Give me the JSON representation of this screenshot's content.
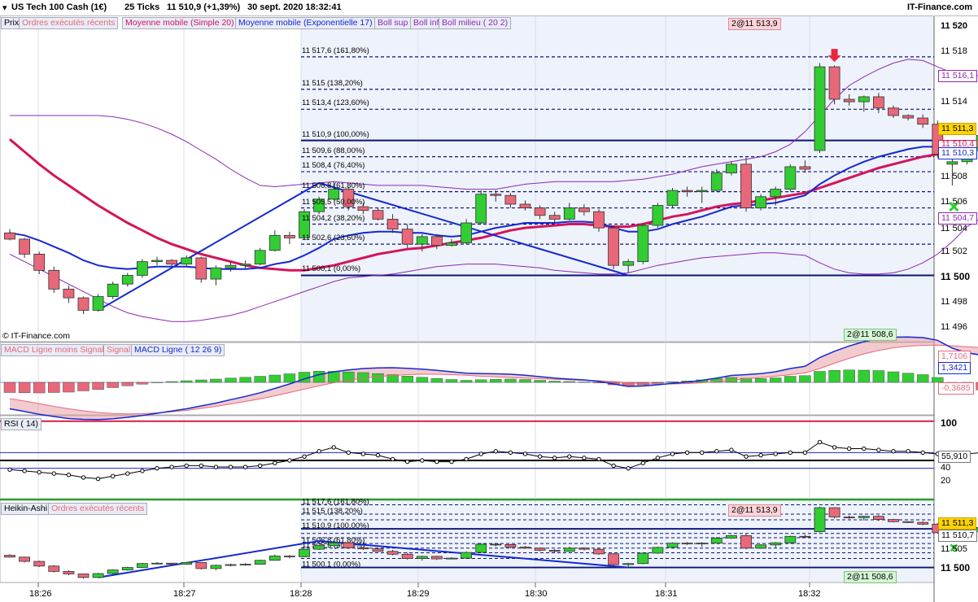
{
  "header": {
    "instrument": "US Tech 100 Cash (1€)",
    "ticks": "25 Ticks",
    "quote": "11 510,9 (+1,39%)",
    "datetime": "30 sept. 2020 18:32:41",
    "brand": "IT-Finance.com"
  },
  "panels": {
    "price": {
      "legend": [
        "Prix",
        "Ordres exécutés récents",
        "Moyenne mobile (Simple 20)",
        "Moyenne mobile (Exponentielle 17)",
        "Boll sup",
        "Boll inf",
        "Boll milieu ( 20 2)"
      ],
      "copyright": "© IT-Finance.com",
      "order_top": "2@11 513,9",
      "order_bottom": "2@11 508,6",
      "axis_ticks": [
        "11 520",
        "11 518",
        "11 516",
        "11 514",
        "11 512",
        "11 510",
        "11 508",
        "11 506",
        "11 504",
        "11 502",
        "11 500",
        "11 498",
        "11 496"
      ],
      "tags": {
        "boll_up": "11 516,1",
        "close": "11 511,3",
        "sma": "11 510,4",
        "ema": "11 510,3",
        "boll_low": "11 504,7"
      }
    },
    "macd": {
      "legend": [
        "MACD Ligne moins Signal",
        "Signal",
        "MACD Ligne ( 12 26 9)"
      ],
      "tags": {
        "signal": "1,7106",
        "macd": "1,3421",
        "hist": "-0,3685"
      }
    },
    "rsi": {
      "legend": [
        "RSI ( 14)"
      ],
      "axis_ticks": [
        "100",
        "60",
        "40",
        "20"
      ],
      "tags": {
        "rsi": "55,910"
      }
    },
    "ha": {
      "legend": [
        "Heikin-Ashi",
        "Ordres exécutés récents"
      ],
      "order_top": "2@11 513,9",
      "order_bottom": "2@11 508,6",
      "axis_ticks": [
        "11 505",
        "11 500"
      ],
      "tags": {
        "close": "11 511,3",
        "sma": "11 510,7"
      }
    }
  },
  "time_labels": [
    "18:26",
    "18:27",
    "18:28",
    "18:29",
    "18:30",
    "18:31",
    "18:32"
  ],
  "chart_data": {
    "type": "candlestick",
    "ylim": [
      11495,
      11521
    ],
    "colors": {
      "up": "#32cd32",
      "down": "#e8687a",
      "sma": "#d4145a",
      "ema": "#1428d2",
      "boll": "#8c28b4",
      "fib": "#0a1478",
      "rsi_hi": "#d21e46",
      "rsi_lo": "#14a014"
    },
    "candles": [
      [
        11503.5,
        11503.8,
        11502.9,
        11503.0
      ],
      [
        11503.0,
        11503.1,
        11501.5,
        11501.8
      ],
      [
        11501.8,
        11502.0,
        11500.2,
        11500.5
      ],
      [
        11500.5,
        11500.8,
        11498.7,
        11499.0
      ],
      [
        11499.0,
        11499.3,
        11497.9,
        11498.3
      ],
      [
        11498.3,
        11498.4,
        11497.0,
        11497.3
      ],
      [
        11497.3,
        11498.6,
        11497.2,
        11498.4
      ],
      [
        11498.4,
        11499.6,
        11498.2,
        11499.4
      ],
      [
        11499.4,
        11500.3,
        11499.2,
        11500.1
      ],
      [
        11500.1,
        11501.4,
        11499.9,
        11501.2
      ],
      [
        11501.2,
        11501.6,
        11500.9,
        11501.3
      ],
      [
        11501.3,
        11501.4,
        11500.8,
        11501.0
      ],
      [
        11501.0,
        11501.7,
        11500.8,
        11501.5
      ],
      [
        11501.5,
        11501.6,
        11499.5,
        11499.8
      ],
      [
        11499.8,
        11500.9,
        11499.3,
        11500.7
      ],
      [
        11500.7,
        11501.2,
        11500.4,
        11500.9
      ],
      [
        11500.9,
        11501.3,
        11500.6,
        11501.0
      ],
      [
        11501.0,
        11502.3,
        11500.9,
        11502.1
      ],
      [
        11502.1,
        11503.7,
        11502.0,
        11503.3
      ],
      [
        11503.3,
        11503.6,
        11502.6,
        11503.1
      ],
      [
        11503.1,
        11505.4,
        11503.0,
        11505.2
      ],
      [
        11505.2,
        11506.4,
        11505.0,
        11506.2
      ],
      [
        11506.2,
        11507.6,
        11506.1,
        11507.0
      ],
      [
        11507.0,
        11507.2,
        11505.3,
        11505.6
      ],
      [
        11505.6,
        11505.9,
        11505.0,
        11505.3
      ],
      [
        11505.3,
        11505.5,
        11504.5,
        11504.6
      ],
      [
        11504.6,
        11505.0,
        11503.5,
        11503.8
      ],
      [
        11503.8,
        11504.2,
        11502.3,
        11502.6
      ],
      [
        11502.6,
        11503.4,
        11502.0,
        11503.2
      ],
      [
        11503.2,
        11503.4,
        11502.2,
        11502.5
      ],
      [
        11502.5,
        11503.0,
        11502.4,
        11502.7
      ],
      [
        11502.7,
        11504.6,
        11502.6,
        11504.3
      ],
      [
        11504.3,
        11506.9,
        11504.2,
        11506.6
      ],
      [
        11506.6,
        11506.9,
        11506.0,
        11506.5
      ],
      [
        11506.5,
        11506.7,
        11505.5,
        11505.8
      ],
      [
        11505.8,
        11506.1,
        11505.3,
        11505.5
      ],
      [
        11505.5,
        11505.7,
        11504.6,
        11504.9
      ],
      [
        11504.9,
        11505.2,
        11504.3,
        11504.6
      ],
      [
        11504.6,
        11505.9,
        11504.5,
        11505.5
      ],
      [
        11505.5,
        11505.8,
        11504.9,
        11505.2
      ],
      [
        11505.2,
        11505.4,
        11503.6,
        11503.9
      ],
      [
        11503.9,
        11504.1,
        11500.6,
        11500.9
      ],
      [
        11500.9,
        11501.4,
        11500.3,
        11501.2
      ],
      [
        11501.2,
        11504.3,
        11501.0,
        11504.1
      ],
      [
        11504.1,
        11505.9,
        11503.9,
        11505.7
      ],
      [
        11505.7,
        11507.1,
        11505.5,
        11506.9
      ],
      [
        11506.9,
        11507.2,
        11506.4,
        11506.8
      ],
      [
        11506.8,
        11507.2,
        11505.9,
        11506.9
      ],
      [
        11506.9,
        11508.6,
        11506.8,
        11508.3
      ],
      [
        11508.3,
        11509.2,
        11508.1,
        11509.0
      ],
      [
        11509.0,
        11509.5,
        11505.2,
        11505.5
      ],
      [
        11505.5,
        11506.6,
        11505.3,
        11506.4
      ],
      [
        11506.4,
        11507.2,
        11505.7,
        11507.0
      ],
      [
        11507.0,
        11509.0,
        11506.8,
        11508.8
      ],
      [
        11508.8,
        11509.3,
        11508.3,
        11508.6
      ],
      [
        11510.1,
        11517.1,
        11509.9,
        11516.8
      ],
      [
        11516.8,
        11516.9,
        11513.8,
        11514.2
      ],
      [
        11514.2,
        11514.6,
        11513.7,
        11514.0
      ],
      [
        11514.0,
        11514.5,
        11513.2,
        11514.4
      ],
      [
        11514.4,
        11514.7,
        11513.1,
        11513.5
      ],
      [
        11513.5,
        11513.7,
        11512.7,
        11512.9
      ],
      [
        11512.9,
        11513.0,
        11512.5,
        11512.7
      ],
      [
        11512.7,
        11513.0,
        11511.9,
        11512.2
      ],
      [
        11512.2,
        11512.5,
        11509.5,
        11509.8
      ],
      [
        11509.0,
        11509.4,
        11507.3,
        11509.2
      ],
      [
        11509.2,
        11510.4,
        11509.0,
        11510.1
      ],
      [
        11510.1,
        11511.7,
        11510.0,
        11511.3
      ]
    ],
    "sma20": [
      11511.0,
      11510.0,
      11509.0,
      11508.1,
      11507.3,
      11506.5,
      11505.7,
      11505.0,
      11504.3,
      11503.7,
      11503.1,
      11502.6,
      11502.2,
      11501.8,
      11501.5,
      11501.2,
      11500.9,
      11500.7,
      11500.6,
      11500.5,
      11500.5,
      11500.7,
      11500.9,
      11501.2,
      11501.5,
      11501.8,
      11502.0,
      11502.2,
      11502.3,
      11502.5,
      11502.7,
      11502.9,
      11503.1,
      11503.4,
      11503.7,
      11503.9,
      11504.0,
      11504.1,
      11504.2,
      11504.2,
      11504.1,
      11504.0,
      11504.0,
      11504.2,
      11504.5,
      11504.8,
      11505.0,
      11505.3,
      11505.6,
      11505.8,
      11505.9,
      11506.1,
      11506.3,
      11506.5,
      11506.7,
      11507.1,
      11507.5,
      11507.9,
      11508.3,
      11508.7,
      11509.0,
      11509.3,
      11509.6,
      11509.8,
      11510.0,
      11510.3,
      11510.4
    ],
    "ema17": [
      11503.5,
      11503.3,
      11502.9,
      11502.4,
      11501.9,
      11501.3,
      11500.9,
      11500.7,
      11500.6,
      11500.7,
      11500.8,
      11500.8,
      11500.8,
      11500.7,
      11500.6,
      11500.6,
      11500.6,
      11500.7,
      11501.0,
      11501.2,
      11501.7,
      11502.3,
      11503.0,
      11503.3,
      11503.5,
      11503.6,
      11503.6,
      11503.5,
      11503.5,
      11503.3,
      11503.2,
      11503.3,
      11503.6,
      11503.9,
      11504.1,
      11504.3,
      11504.3,
      11504.3,
      11504.4,
      11504.4,
      11504.3,
      11503.9,
      11503.6,
      11503.6,
      11503.8,
      11504.2,
      11504.5,
      11504.8,
      11505.2,
      11505.6,
      11505.7,
      11505.8,
      11505.9,
      11506.2,
      11506.5,
      11507.4,
      11508.1,
      11508.7,
      11509.2,
      11509.6,
      11509.9,
      11510.2,
      11510.4,
      11510.4,
      11510.3,
      11510.3,
      11510.3
    ],
    "boll_up": [
      11512.9,
      11512.9,
      11512.9,
      11512.9,
      11512.9,
      11512.9,
      11512.9,
      11512.8,
      11512.6,
      11512.3,
      11511.9,
      11511.4,
      11510.8,
      11510.1,
      11509.4,
      11508.6,
      11507.9,
      11507.3,
      11507.2,
      11507.3,
      11507.4,
      11507.5,
      11507.6,
      11507.5,
      11507.4,
      11507.3,
      11507.3,
      11507.3,
      11507.3,
      11507.2,
      11507.1,
      11507.0,
      11507.0,
      11507.0,
      11507.2,
      11507.4,
      11507.5,
      11507.6,
      11507.6,
      11507.6,
      11507.6,
      11507.6,
      11507.7,
      11507.8,
      11508.0,
      11508.2,
      11508.5,
      11508.8,
      11509.0,
      11509.2,
      11509.4,
      11509.6,
      11510.0,
      11510.6,
      11511.6,
      11512.9,
      11514.2,
      11515.3,
      11516.0,
      11516.6,
      11517.1,
      11517.4,
      11517.3,
      11516.8,
      11516.3,
      11516.1,
      11516.1
    ],
    "boll_low": [
      11501.8,
      11501.2,
      11500.6,
      11500.0,
      11499.4,
      11498.8,
      11498.2,
      11497.6,
      11497.1,
      11496.8,
      11496.6,
      11496.4,
      11496.4,
      11496.5,
      11496.7,
      11496.9,
      11497.2,
      11497.6,
      11498.0,
      11498.4,
      11498.8,
      11499.2,
      11499.6,
      11499.9,
      11500.0,
      11500.1,
      11500.2,
      11500.4,
      11500.6,
      11500.8,
      11500.9,
      11501.0,
      11501.0,
      11501.0,
      11500.9,
      11500.8,
      11500.7,
      11500.5,
      11500.4,
      11500.3,
      11500.2,
      11500.2,
      11500.3,
      11500.6,
      11500.9,
      11501.1,
      11501.3,
      11501.5,
      11501.6,
      11501.7,
      11501.8,
      11501.9,
      11501.9,
      11501.8,
      11501.7,
      11501.1,
      11500.6,
      11500.3,
      11500.2,
      11500.2,
      11500.3,
      11500.6,
      11501.1,
      11501.8,
      11502.8,
      11504.0,
      11504.7
    ],
    "fibonacci": [
      {
        "label": "11 517,6 (161,80%)",
        "price": 11517.6
      },
      {
        "label": "11 515 (138,20%)",
        "price": 11515.0
      },
      {
        "label": "11 513,4 (123,60%)",
        "price": 11513.4
      },
      {
        "label": "11 510,9 (100,00%)",
        "price": 11510.9
      },
      {
        "label": "11 509,6 (88,00%)",
        "price": 11509.6
      },
      {
        "label": "11 508,4 (76,40%)",
        "price": 11508.4
      },
      {
        "label": "11 506,8 (61,80%)",
        "price": 11506.8
      },
      {
        "label": "11 505,5 (50,00%)",
        "price": 11505.5
      },
      {
        "label": "11 504,2 (38,20%)",
        "price": 11504.2
      },
      {
        "label": "11 502,6 (23,60%)",
        "price": 11502.6
      },
      {
        "label": "11 500,1 (0,00%)",
        "price": 11500.1
      }
    ],
    "trend_lines": [
      {
        "from": [
          6,
          11497.3
        ],
        "to": [
          21,
          11507.5
        ]
      },
      {
        "from": [
          21,
          11507.5
        ],
        "to": [
          42,
          11500.1
        ]
      }
    ],
    "macd_hist": [
      -0.5,
      -0.51,
      -0.52,
      -0.5,
      -0.48,
      -0.42,
      -0.35,
      -0.26,
      -0.17,
      -0.09,
      -0.02,
      0.04,
      0.08,
      0.12,
      0.16,
      0.21,
      0.25,
      0.3,
      0.36,
      0.42,
      0.5,
      0.55,
      0.54,
      0.51,
      0.48,
      0.43,
      0.38,
      0.31,
      0.25,
      0.19,
      0.14,
      0.1,
      0.13,
      0.15,
      0.16,
      0.14,
      0.1,
      0.06,
      0.04,
      0.02,
      -0.03,
      -0.12,
      -0.18,
      -0.12,
      -0.04,
      0.03,
      0.07,
      0.12,
      0.18,
      0.24,
      0.2,
      0.19,
      0.22,
      0.3,
      0.33,
      0.54,
      0.59,
      0.61,
      0.6,
      0.58,
      0.52,
      0.45,
      0.38,
      0.24,
      -0.12,
      -0.3,
      -0.37
    ],
    "macd_signal": [
      -0.8,
      -0.92,
      -1.05,
      -1.18,
      -1.3,
      -1.4,
      -1.48,
      -1.53,
      -1.55,
      -1.54,
      -1.5,
      -1.45,
      -1.38,
      -1.28,
      -1.18,
      -1.06,
      -0.94,
      -0.81,
      -0.66,
      -0.5,
      -0.33,
      -0.17,
      -0.02,
      0.1,
      0.2,
      0.28,
      0.34,
      0.38,
      0.4,
      0.4,
      0.38,
      0.35,
      0.3,
      0.27,
      0.24,
      0.21,
      0.18,
      0.15,
      0.12,
      0.1,
      0.08,
      0.04,
      -0.02,
      -0.06,
      -0.08,
      -0.08,
      -0.06,
      -0.02,
      0.03,
      0.1,
      0.18,
      0.24,
      0.3,
      0.38,
      0.46,
      0.68,
      0.94,
      1.18,
      1.4,
      1.57,
      1.7,
      1.78,
      1.82,
      1.83,
      1.8,
      1.75,
      1.71
    ],
    "macd_line": [
      -1.3,
      -1.43,
      -1.57,
      -1.68,
      -1.78,
      -1.82,
      -1.83,
      -1.79,
      -1.72,
      -1.63,
      -1.52,
      -1.41,
      -1.3,
      -1.16,
      -1.02,
      -0.85,
      -0.69,
      -0.51,
      -0.3,
      -0.08,
      0.17,
      0.38,
      0.52,
      0.61,
      0.68,
      0.71,
      0.72,
      0.69,
      0.65,
      0.59,
      0.52,
      0.45,
      0.43,
      0.42,
      0.4,
      0.35,
      0.28,
      0.21,
      0.16,
      0.12,
      0.05,
      -0.08,
      -0.2,
      -0.18,
      -0.12,
      -0.05,
      0.01,
      0.1,
      0.21,
      0.34,
      0.38,
      0.43,
      0.52,
      0.68,
      0.79,
      1.22,
      1.53,
      1.79,
      2.0,
      2.15,
      2.22,
      2.23,
      2.2,
      2.07,
      1.68,
      1.45,
      1.34
    ],
    "rsi": [
      43,
      42,
      41,
      40,
      39,
      37,
      36,
      38,
      40,
      42,
      44,
      45,
      46,
      46,
      45,
      45,
      45,
      46,
      48,
      50,
      53,
      57,
      60,
      56,
      55,
      54,
      51,
      49,
      50,
      49,
      49,
      51,
      55,
      57,
      56,
      55,
      53,
      52,
      53,
      52,
      51,
      46,
      44,
      48,
      52,
      55,
      56,
      56,
      57,
      58,
      53,
      54,
      55,
      56,
      56,
      64,
      60,
      59,
      59,
      58,
      57,
      57,
      56,
      55,
      54,
      55,
      56
    ]
  }
}
